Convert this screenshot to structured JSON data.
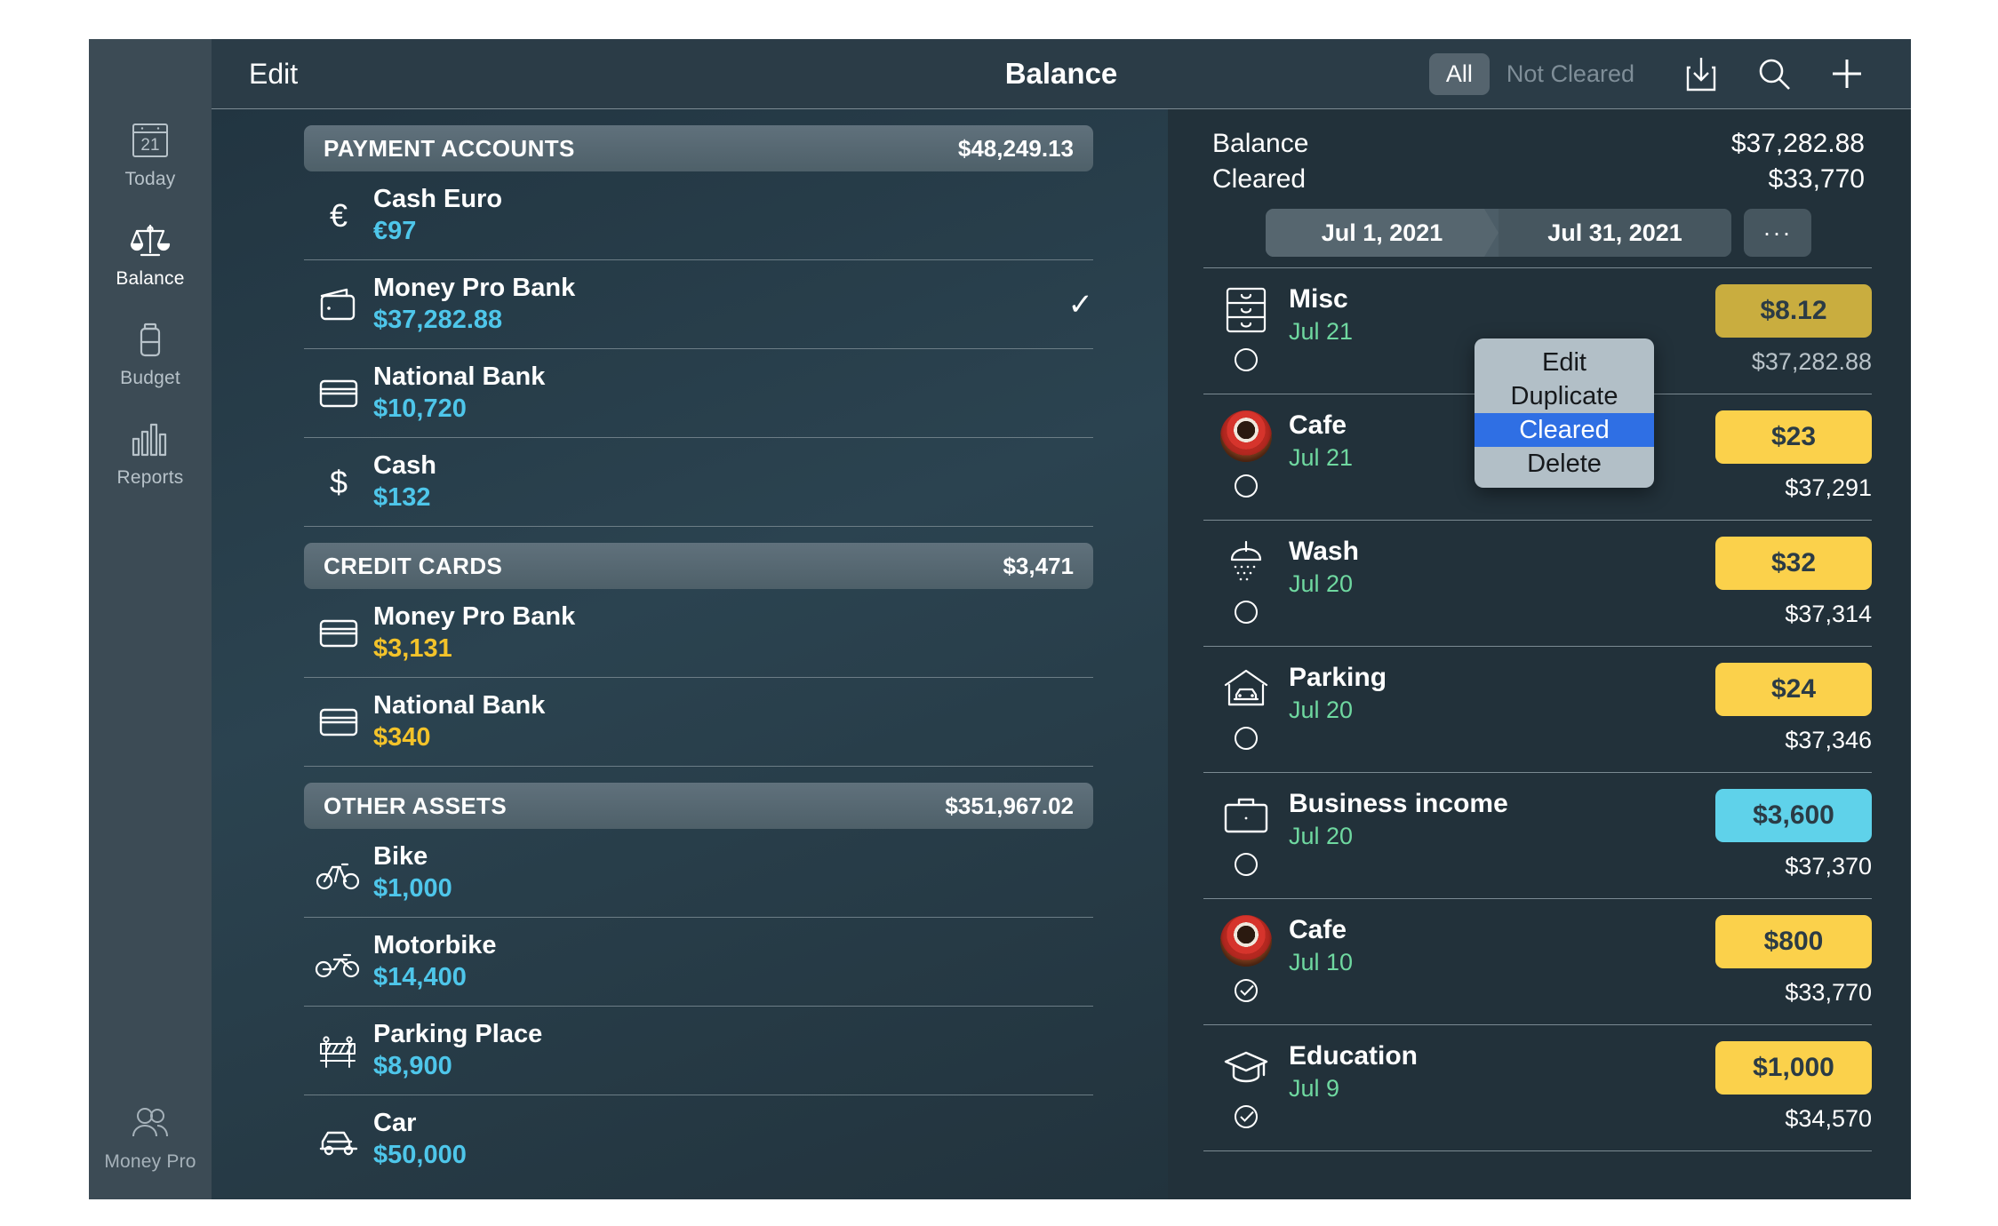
{
  "window": {
    "title": "Balance",
    "edit_label": "Edit"
  },
  "rail": {
    "items": [
      {
        "label": "Today",
        "icon": "calendar-icon",
        "day": "21",
        "active": false
      },
      {
        "label": "Balance",
        "icon": "scales-icon",
        "active": true
      },
      {
        "label": "Budget",
        "icon": "battery-icon",
        "active": false
      },
      {
        "label": "Reports",
        "icon": "bar-chart-icon",
        "active": false
      }
    ],
    "bottom": {
      "label": "Money Pro",
      "icon": "users-icon"
    }
  },
  "toolbar": {
    "filters": [
      {
        "label": "All",
        "selected": true
      },
      {
        "label": "Not Cleared",
        "selected": false
      }
    ],
    "icons": [
      "import-icon",
      "search-icon",
      "add-icon"
    ]
  },
  "accounts": {
    "groups": [
      {
        "title": "PAYMENT ACCOUNTS",
        "total": "$48,249.13",
        "rows": [
          {
            "name": "Cash Euro",
            "amount": "€97",
            "icon": "euro-icon",
            "tone": "cyan",
            "checked": false
          },
          {
            "name": "Money Pro Bank",
            "amount": "$37,282.88",
            "icon": "wallet-icon",
            "tone": "cyan",
            "checked": true
          },
          {
            "name": "National Bank",
            "amount": "$10,720",
            "icon": "card-icon",
            "tone": "cyan",
            "checked": false
          },
          {
            "name": "Cash",
            "amount": "$132",
            "icon": "dollar-icon",
            "tone": "cyan",
            "checked": false
          }
        ]
      },
      {
        "title": "CREDIT CARDS",
        "total": "$3,471",
        "rows": [
          {
            "name": "Money Pro Bank",
            "amount": "$3,131",
            "icon": "card-icon",
            "tone": "amber",
            "checked": false
          },
          {
            "name": "National Bank",
            "amount": "$340",
            "icon": "card-icon",
            "tone": "amber",
            "checked": false
          }
        ]
      },
      {
        "title": "OTHER ASSETS",
        "total": "$351,967.02",
        "rows": [
          {
            "name": "Bike",
            "amount": "$1,000",
            "icon": "bicycle-icon",
            "tone": "cyan",
            "checked": false
          },
          {
            "name": "Motorbike",
            "amount": "$14,400",
            "icon": "motorbike-icon",
            "tone": "cyan",
            "checked": false
          },
          {
            "name": "Parking Place",
            "amount": "$8,900",
            "icon": "barrier-icon",
            "tone": "cyan",
            "checked": false
          },
          {
            "name": "Car",
            "amount": "$50,000",
            "icon": "car-icon",
            "tone": "cyan",
            "checked": false
          }
        ]
      }
    ]
  },
  "summary": {
    "balance_label": "Balance",
    "balance_value": "$37,282.88",
    "cleared_label": "Cleared",
    "cleared_value": "$33,770",
    "date_from": "Jul 1, 2021",
    "date_to": "Jul 31, 2021",
    "more_label": "···"
  },
  "transactions": [
    {
      "name": "Misc",
      "date": "Jul 21",
      "amount": "$8.12",
      "running": "$37,282.88",
      "icon": "drawers-icon",
      "kind": "expense",
      "cleared": false,
      "dimmed": true
    },
    {
      "name": "Cafe",
      "date": "Jul 21",
      "amount": "$23",
      "running": "$37,291",
      "icon": "coffee-photo-icon",
      "kind": "expense",
      "cleared": false,
      "dimmed": false
    },
    {
      "name": "Wash",
      "date": "Jul 20",
      "amount": "$32",
      "running": "$37,314",
      "icon": "shower-icon",
      "kind": "expense",
      "cleared": false,
      "dimmed": false
    },
    {
      "name": "Parking",
      "date": "Jul 20",
      "amount": "$24",
      "running": "$37,346",
      "icon": "garage-icon",
      "kind": "expense",
      "cleared": false,
      "dimmed": false
    },
    {
      "name": "Business income",
      "date": "Jul 20",
      "amount": "$3,600",
      "running": "$37,370",
      "icon": "briefcase-icon",
      "kind": "income",
      "cleared": false,
      "dimmed": false
    },
    {
      "name": "Cafe",
      "date": "Jul 10",
      "amount": "$800",
      "running": "$33,770",
      "icon": "coffee-photo-icon",
      "kind": "expense",
      "cleared": true,
      "dimmed": false
    },
    {
      "name": "Education",
      "date": "Jul 9",
      "amount": "$1,000",
      "running": "$34,570",
      "icon": "graduation-cap-icon",
      "kind": "expense",
      "cleared": true,
      "dimmed": false
    }
  ],
  "context_menu": {
    "items": [
      {
        "label": "Edit",
        "selected": false
      },
      {
        "label": "Duplicate",
        "selected": false
      },
      {
        "label": "Cleared",
        "selected": true
      },
      {
        "label": "Delete",
        "selected": false
      }
    ]
  },
  "colors": {
    "accent_cyan": "#4ec6ea",
    "accent_amber": "#f3c32a",
    "expense_badge": "#fbd14b",
    "income_badge": "#5fd2ea",
    "date_green": "#6fd8a0",
    "menu_highlight": "#2f6fe4",
    "window_bg": "#22313a",
    "rail_bg": "#3c4b55"
  }
}
